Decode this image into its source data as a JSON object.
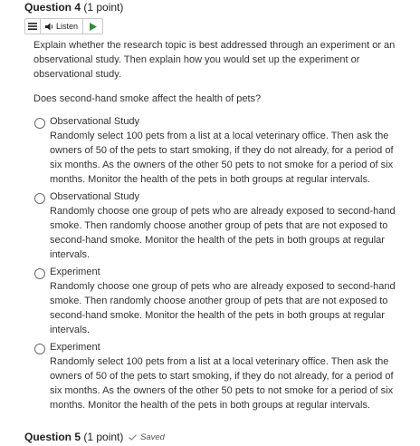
{
  "question4": {
    "title": "Question 4",
    "points": "(1 point)"
  },
  "toolbar": {
    "listen_label": "Listen"
  },
  "prompt": "Explain whether the research topic is best addressed through an experiment or an observational study. Then explain how you would set up the experiment or observational study.",
  "question": "Does second-hand smoke affect the health of pets?",
  "options": [
    {
      "title": "Observational Study",
      "body": "Randomly select 100 pets from a list at a local veterinary office. Then ask the owners of 50 of the pets to start smoking, if they do not already, for a period of six months. As the owners of the other 50 pets to not smoke for a period of six months. Monitor the health of the pets in both groups at regular intervals."
    },
    {
      "title": "Observational Study",
      "body": "Randomly choose one group of pets who are already exposed to second-hand smoke. Then randomly choose another group of pets that are not exposed to second-hand smoke. Monitor the health of the pets in both groups at regular intervals."
    },
    {
      "title": "Experiment",
      "body": "Randomly choose one group of pets who are already exposed to second-hand smoke. Then randomly choose another group of pets that are not exposed to second-hand smoke. Monitor the health of the pets in both groups at regular intervals."
    },
    {
      "title": "Experiment",
      "body": "Randomly select 100 pets from a list at a local veterinary office. Then ask the owners of 50 of the pets to start smoking, if they do not already, for a period of six months. As the owners of the other 50 pets to not smoke for a period of six months. Monitor the health of the pets in both groups at regular intervals."
    }
  ],
  "question5": {
    "title": "Question 5",
    "points": "(1 point)",
    "status": "Saved"
  },
  "icons": {
    "menu": "hamburger-menu-icon",
    "listen": "speaker-icon",
    "play": "play-icon",
    "saved": "checkmark-icon"
  },
  "colors": {
    "play": "#2e8b3a",
    "text": "#333333",
    "border": "#c8c8c8"
  }
}
